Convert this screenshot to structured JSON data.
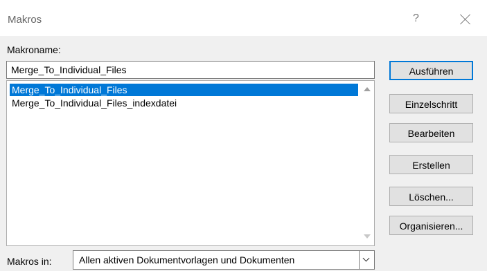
{
  "window": {
    "title": "Makros",
    "help_label": "?"
  },
  "form": {
    "name_label": "Makroname:",
    "name_value": "Merge_To_Individual_Files",
    "macros": [
      {
        "label": "Merge_To_Individual_Files",
        "selected": true
      },
      {
        "label": "Merge_To_Individual_Files_indexdatei",
        "selected": false
      }
    ],
    "macros_in_label": "Makros in:",
    "macros_in_value": "Allen aktiven Dokumentvorlagen und Dokumenten"
  },
  "buttons": {
    "run": "Ausführen",
    "step": "Einzelschritt",
    "edit": "Bearbeiten",
    "create": "Erstellen",
    "delete": "Löschen...",
    "organize": "Organisieren..."
  },
  "colors": {
    "accent": "#0078d7",
    "background": "#f0f0f0"
  },
  "icons": {
    "close": "close-icon",
    "help": "help-icon",
    "scroll_up": "chevron-up-icon",
    "scroll_down": "chevron-down-icon",
    "dropdown": "chevron-down-icon"
  }
}
